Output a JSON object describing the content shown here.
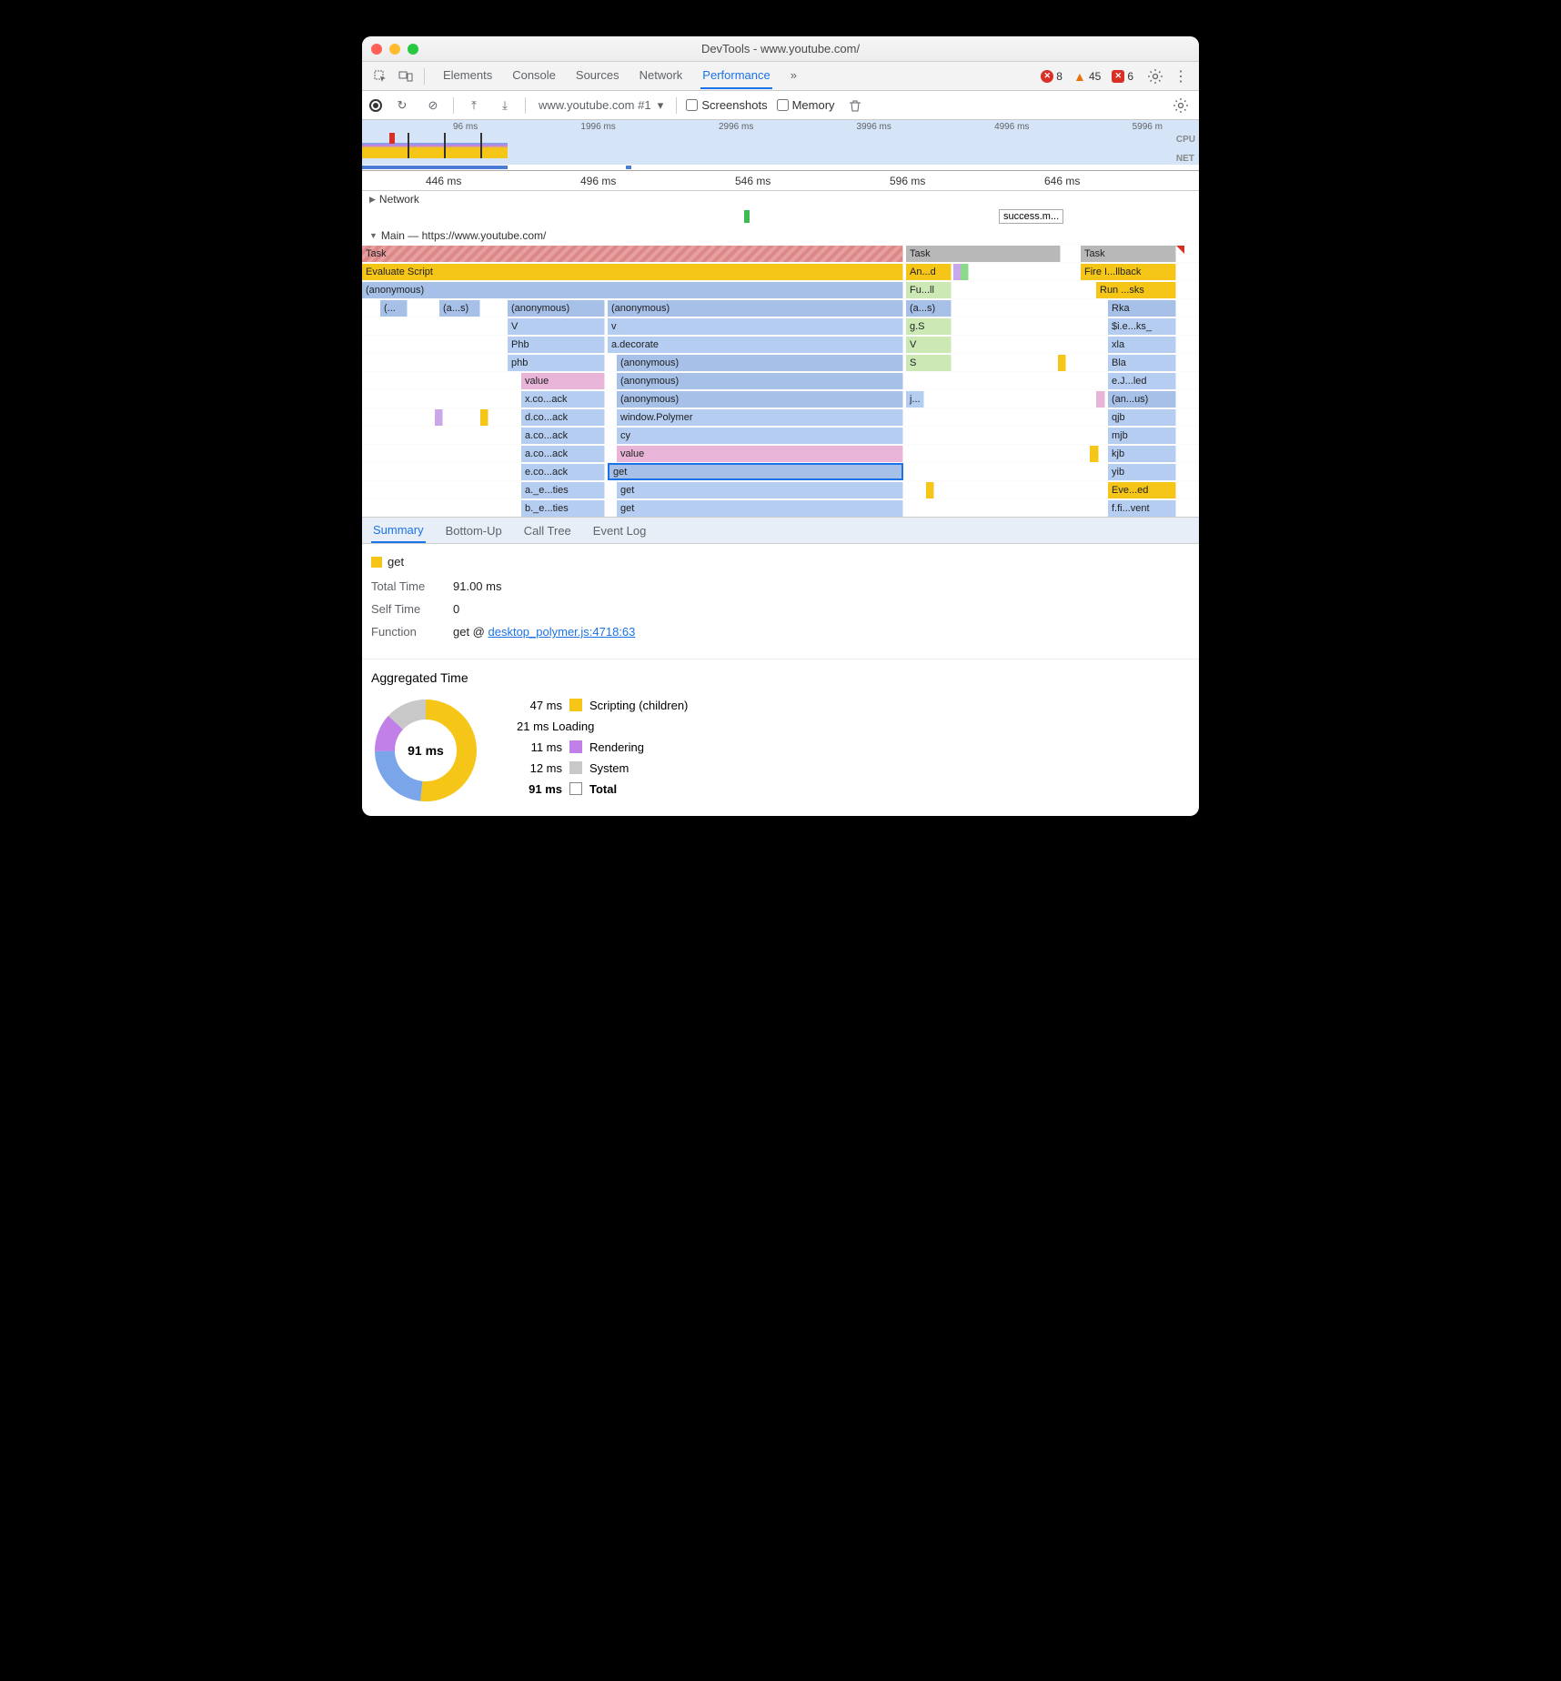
{
  "window": {
    "title": "DevTools - www.youtube.com/"
  },
  "mainTabs": [
    "Elements",
    "Console",
    "Sources",
    "Network",
    "Performance"
  ],
  "mainTabActive": "Performance",
  "issues": {
    "errors": 8,
    "warnings": 45,
    "issues": 6
  },
  "toolbar2": {
    "target": "www.youtube.com #1",
    "screenshots": "Screenshots",
    "memory": "Memory"
  },
  "overview": {
    "ticks": [
      "96 ms",
      "1996 ms",
      "2996 ms",
      "3996 ms",
      "4996 ms",
      "5996 m"
    ],
    "cpu": "CPU",
    "net": "NET"
  },
  "ruler": [
    "446 ms",
    "496 ms",
    "546 ms",
    "596 ms",
    "646 ms"
  ],
  "networkHeader": "Network",
  "networkItem": "success.m...",
  "mainHeader": "Main — https://www.youtube.com/",
  "flame": {
    "col1": {
      "task": "Task",
      "eval": "Evaluate Script",
      "anon0": "(anonymous)",
      "r4a": "(...",
      "r4b": "(a...s)",
      "r4c": "(anonymous)",
      "r4d": "(anonymous)",
      "r5c": "V",
      "r5d": "v",
      "r6c": "Phb",
      "r6d": "a.decorate",
      "r7c": "phb",
      "r7d": "(anonymous)",
      "r8c": "value",
      "r8d": "(anonymous)",
      "r9c": "x.co...ack",
      "r9d": "(anonymous)",
      "r10c": "d.co...ack",
      "r10d": "window.Polymer",
      "r11c": "a.co...ack",
      "r11d": "cy",
      "r12c": "a.co...ack",
      "r12d": "value",
      "r13c": "e.co...ack",
      "r13d": "get",
      "r14c": "a._e...ties",
      "r14d": "get",
      "r15c": "b._e...ties",
      "r15d": "get"
    },
    "col2": {
      "task": "Task",
      "r2": "An...d",
      "r3": "Fu...ll",
      "r4": "(a...s)",
      "r5": "g.S",
      "r6": "V",
      "r7": "S",
      "r9": "j..."
    },
    "col3": {
      "task": "Task",
      "r2": "Fire I...llback",
      "r3": "Run ...sks",
      "r4": "Rka",
      "r5": "$i.e...ks_",
      "r6": "xla",
      "r7": "Bla",
      "r8": "e.J...led",
      "r9": "(an...us)",
      "r10": "qjb",
      "r11": "mjb",
      "r12": "kjb",
      "r13": "yib",
      "r14": "Eve...ed",
      "r15": "f.fi...vent"
    }
  },
  "detailTabs": [
    "Summary",
    "Bottom-Up",
    "Call Tree",
    "Event Log"
  ],
  "detailActive": "Summary",
  "summary": {
    "name": "get",
    "totalTimeLabel": "Total Time",
    "totalTime": "91.00 ms",
    "selfTimeLabel": "Self Time",
    "selfTime": "0",
    "functionLabel": "Function",
    "functionPrefix": "get @ ",
    "functionLink": "desktop_polymer.js:4718:63"
  },
  "aggregated": {
    "title": "Aggregated Time",
    "center": "91 ms",
    "rows": [
      {
        "time": "47 ms",
        "color": "#f5c518",
        "label": "Scripting (children)"
      },
      {
        "time": "21 ms",
        "color": "#7aa5e8",
        "label": "Loading"
      },
      {
        "time": "11 ms",
        "color": "#c080e8",
        "label": "Rendering"
      },
      {
        "time": "12 ms",
        "color": "#c8c8c8",
        "label": "System"
      }
    ],
    "total": {
      "time": "91 ms",
      "label": "Total"
    }
  },
  "chart_data": {
    "type": "pie",
    "title": "Aggregated Time",
    "categories": [
      "Scripting (children)",
      "Loading",
      "Rendering",
      "System"
    ],
    "values": [
      47,
      21,
      11,
      12
    ],
    "total": 91,
    "unit": "ms"
  }
}
